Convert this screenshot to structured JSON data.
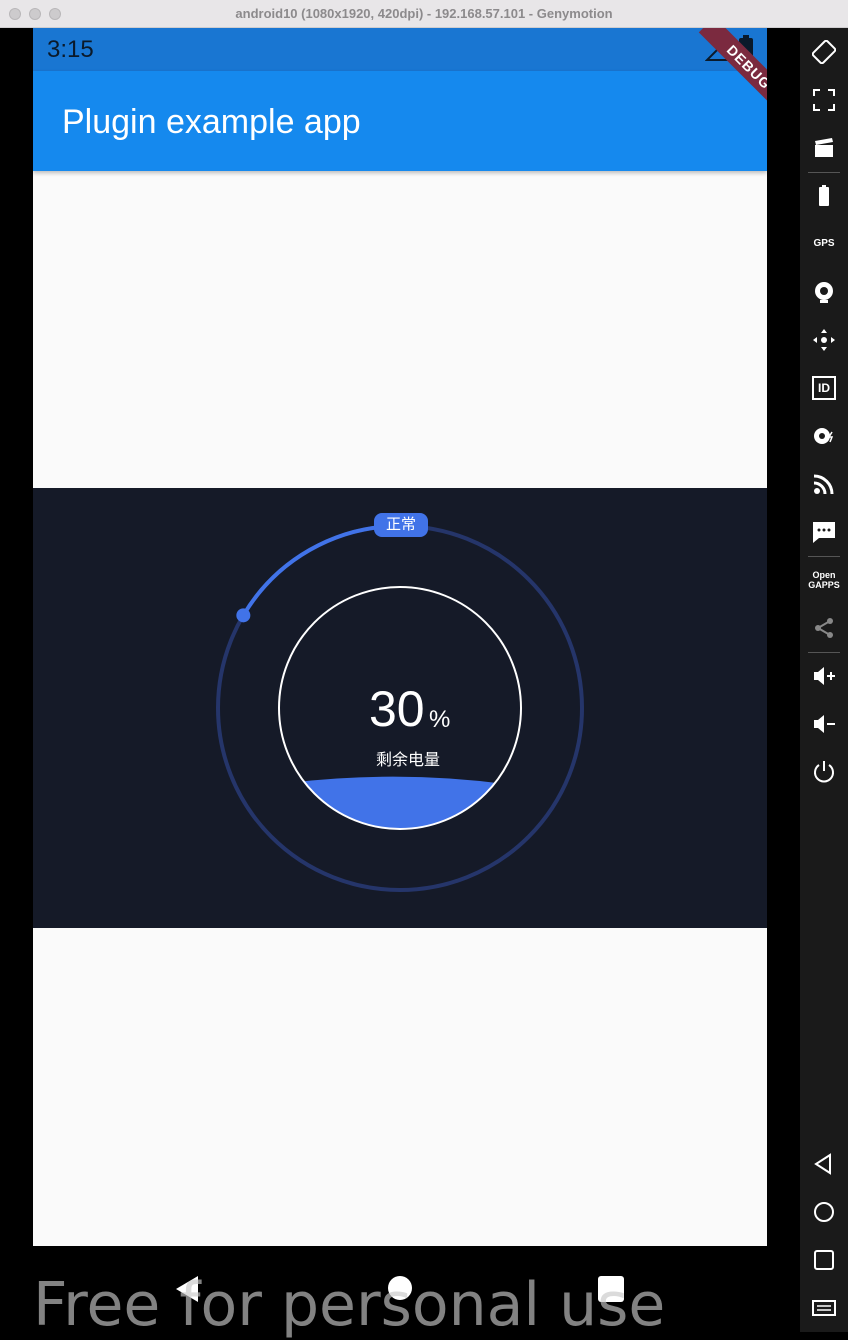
{
  "window": {
    "title": "android10 (1080x1920, 420dpi) - 192.168.57.101 - Genymotion"
  },
  "statusbar": {
    "time": "3:15"
  },
  "appbar": {
    "title": "Plugin example app",
    "debug_banner": "DEBUG"
  },
  "battery_widget": {
    "state_label": "正常",
    "percent_value": "30",
    "percent_sign": "%",
    "remaining_label": "剩余电量",
    "level": 0.3,
    "colors": {
      "panel": "#151a28",
      "accent": "#4173e8",
      "ring_dim": "#25356a"
    }
  },
  "toolbar": {
    "items": [
      "rotate-icon",
      "fullscreen-icon",
      "capture-icon",
      "battery-icon",
      "gps-icon",
      "webcam-icon",
      "navigation-icon",
      "device-id-icon",
      "disk-io-icon",
      "cast-icon",
      "sms-icon",
      "opengapps-icon",
      "share-icon",
      "volume-up-icon",
      "volume-down-icon",
      "power-icon",
      "back-icon",
      "home-icon",
      "recents-icon",
      "menu-icon"
    ],
    "id_label": "ID",
    "gps_label": "GPS",
    "opengapps_label": "Open GAPPS"
  },
  "watermark": "Free for personal use"
}
